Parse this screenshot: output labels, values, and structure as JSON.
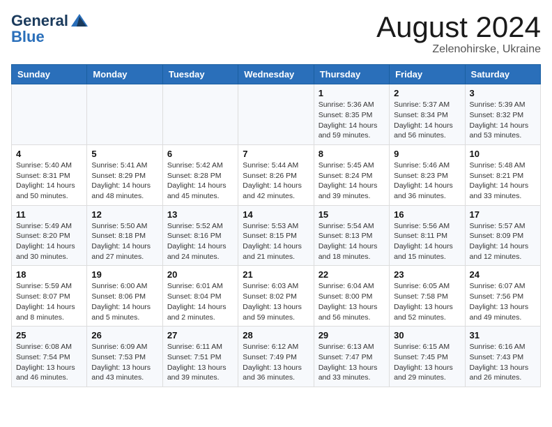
{
  "header": {
    "logo_general": "General",
    "logo_blue": "Blue",
    "month_year": "August 2024",
    "location": "Zelenohirske, Ukraine"
  },
  "weekdays": [
    "Sunday",
    "Monday",
    "Tuesday",
    "Wednesday",
    "Thursday",
    "Friday",
    "Saturday"
  ],
  "weeks": [
    [
      {
        "day": "",
        "info": ""
      },
      {
        "day": "",
        "info": ""
      },
      {
        "day": "",
        "info": ""
      },
      {
        "day": "",
        "info": ""
      },
      {
        "day": "1",
        "info": "Sunrise: 5:36 AM\nSunset: 8:35 PM\nDaylight: 14 hours\nand 59 minutes."
      },
      {
        "day": "2",
        "info": "Sunrise: 5:37 AM\nSunset: 8:34 PM\nDaylight: 14 hours\nand 56 minutes."
      },
      {
        "day": "3",
        "info": "Sunrise: 5:39 AM\nSunset: 8:32 PM\nDaylight: 14 hours\nand 53 minutes."
      }
    ],
    [
      {
        "day": "4",
        "info": "Sunrise: 5:40 AM\nSunset: 8:31 PM\nDaylight: 14 hours\nand 50 minutes."
      },
      {
        "day": "5",
        "info": "Sunrise: 5:41 AM\nSunset: 8:29 PM\nDaylight: 14 hours\nand 48 minutes."
      },
      {
        "day": "6",
        "info": "Sunrise: 5:42 AM\nSunset: 8:28 PM\nDaylight: 14 hours\nand 45 minutes."
      },
      {
        "day": "7",
        "info": "Sunrise: 5:44 AM\nSunset: 8:26 PM\nDaylight: 14 hours\nand 42 minutes."
      },
      {
        "day": "8",
        "info": "Sunrise: 5:45 AM\nSunset: 8:24 PM\nDaylight: 14 hours\nand 39 minutes."
      },
      {
        "day": "9",
        "info": "Sunrise: 5:46 AM\nSunset: 8:23 PM\nDaylight: 14 hours\nand 36 minutes."
      },
      {
        "day": "10",
        "info": "Sunrise: 5:48 AM\nSunset: 8:21 PM\nDaylight: 14 hours\nand 33 minutes."
      }
    ],
    [
      {
        "day": "11",
        "info": "Sunrise: 5:49 AM\nSunset: 8:20 PM\nDaylight: 14 hours\nand 30 minutes."
      },
      {
        "day": "12",
        "info": "Sunrise: 5:50 AM\nSunset: 8:18 PM\nDaylight: 14 hours\nand 27 minutes."
      },
      {
        "day": "13",
        "info": "Sunrise: 5:52 AM\nSunset: 8:16 PM\nDaylight: 14 hours\nand 24 minutes."
      },
      {
        "day": "14",
        "info": "Sunrise: 5:53 AM\nSunset: 8:15 PM\nDaylight: 14 hours\nand 21 minutes."
      },
      {
        "day": "15",
        "info": "Sunrise: 5:54 AM\nSunset: 8:13 PM\nDaylight: 14 hours\nand 18 minutes."
      },
      {
        "day": "16",
        "info": "Sunrise: 5:56 AM\nSunset: 8:11 PM\nDaylight: 14 hours\nand 15 minutes."
      },
      {
        "day": "17",
        "info": "Sunrise: 5:57 AM\nSunset: 8:09 PM\nDaylight: 14 hours\nand 12 minutes."
      }
    ],
    [
      {
        "day": "18",
        "info": "Sunrise: 5:59 AM\nSunset: 8:07 PM\nDaylight: 14 hours\nand 8 minutes."
      },
      {
        "day": "19",
        "info": "Sunrise: 6:00 AM\nSunset: 8:06 PM\nDaylight: 14 hours\nand 5 minutes."
      },
      {
        "day": "20",
        "info": "Sunrise: 6:01 AM\nSunset: 8:04 PM\nDaylight: 14 hours\nand 2 minutes."
      },
      {
        "day": "21",
        "info": "Sunrise: 6:03 AM\nSunset: 8:02 PM\nDaylight: 13 hours\nand 59 minutes."
      },
      {
        "day": "22",
        "info": "Sunrise: 6:04 AM\nSunset: 8:00 PM\nDaylight: 13 hours\nand 56 minutes."
      },
      {
        "day": "23",
        "info": "Sunrise: 6:05 AM\nSunset: 7:58 PM\nDaylight: 13 hours\nand 52 minutes."
      },
      {
        "day": "24",
        "info": "Sunrise: 6:07 AM\nSunset: 7:56 PM\nDaylight: 13 hours\nand 49 minutes."
      }
    ],
    [
      {
        "day": "25",
        "info": "Sunrise: 6:08 AM\nSunset: 7:54 PM\nDaylight: 13 hours\nand 46 minutes."
      },
      {
        "day": "26",
        "info": "Sunrise: 6:09 AM\nSunset: 7:53 PM\nDaylight: 13 hours\nand 43 minutes."
      },
      {
        "day": "27",
        "info": "Sunrise: 6:11 AM\nSunset: 7:51 PM\nDaylight: 13 hours\nand 39 minutes."
      },
      {
        "day": "28",
        "info": "Sunrise: 6:12 AM\nSunset: 7:49 PM\nDaylight: 13 hours\nand 36 minutes."
      },
      {
        "day": "29",
        "info": "Sunrise: 6:13 AM\nSunset: 7:47 PM\nDaylight: 13 hours\nand 33 minutes."
      },
      {
        "day": "30",
        "info": "Sunrise: 6:15 AM\nSunset: 7:45 PM\nDaylight: 13 hours\nand 29 minutes."
      },
      {
        "day": "31",
        "info": "Sunrise: 6:16 AM\nSunset: 7:43 PM\nDaylight: 13 hours\nand 26 minutes."
      }
    ]
  ]
}
